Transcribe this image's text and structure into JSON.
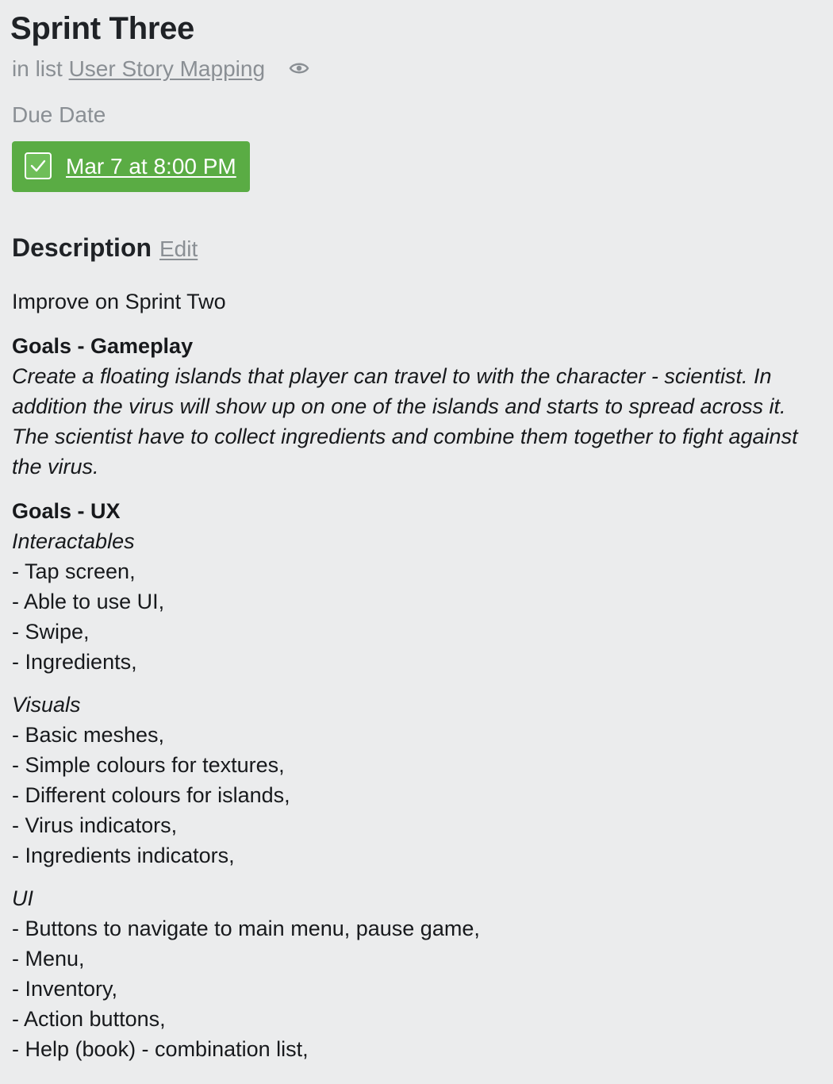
{
  "card": {
    "title": "Sprint Three",
    "in_list_prefix": "in list",
    "list_name": "User Story Mapping",
    "watch_icon": "eye-icon",
    "due_date_label": "Due Date",
    "due_date_value": "Mar 7 at 8:00 PM",
    "due_date_complete": true,
    "due_badge_color": "#5aac44",
    "description_heading": "Description",
    "edit_label": "Edit"
  },
  "description": {
    "intro": "Improve on Sprint Two",
    "gameplay_heading": "Goals - Gameplay",
    "gameplay_text": "Create a floating islands that player can travel to with the character - scientist. In addition the virus will show up on one of the islands and starts to spread across it. The scientist have to collect ingredients and combine them together to fight against the virus.",
    "ux_heading": "Goals - UX",
    "interactables_heading": "Interactables",
    "interactables": [
      "- Tap screen,",
      "- Able to use UI,",
      "- Swipe,",
      "- Ingredients,"
    ],
    "visuals_heading": "Visuals",
    "visuals": [
      "- Basic meshes,",
      "- Simple colours for textures,",
      "- Different colours for islands,",
      "- Virus indicators,",
      "- Ingredients indicators,"
    ],
    "ui_heading": "UI",
    "ui": [
      "- Buttons to navigate to main menu, pause game,",
      "- Menu,",
      "- Inventory,",
      "- Action buttons,",
      "- Help (book) - combination list,"
    ]
  }
}
